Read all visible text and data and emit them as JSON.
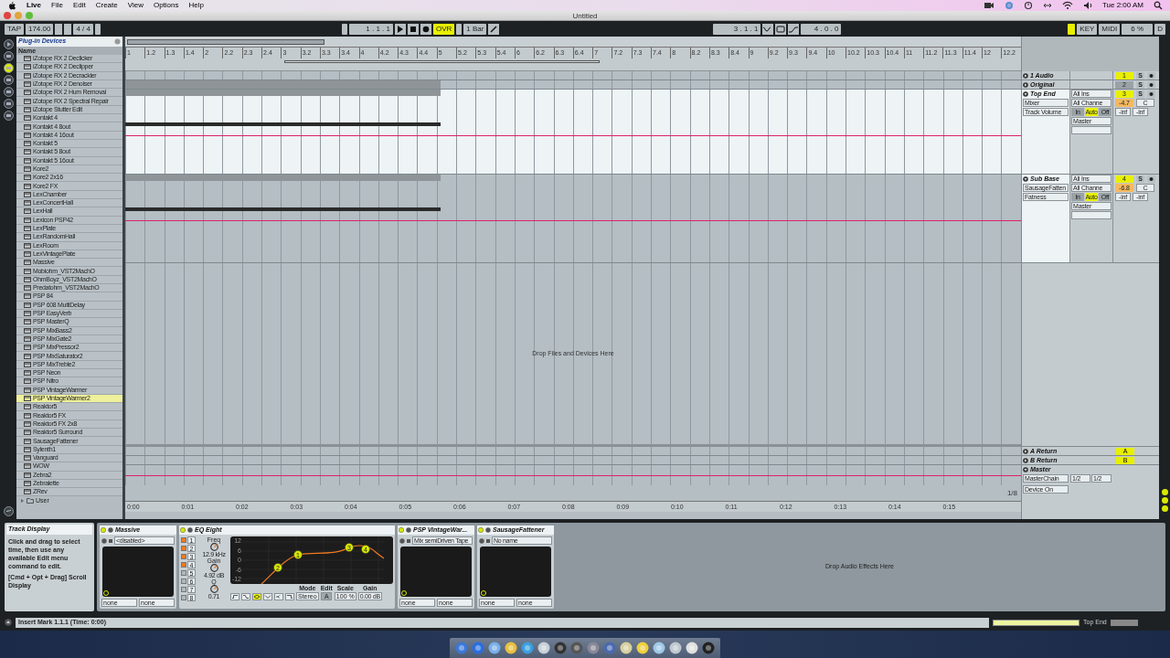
{
  "menubar": {
    "app": "Live",
    "menus": [
      "File",
      "Edit",
      "Create",
      "View",
      "Options",
      "Help"
    ],
    "clock": "Tue 2:00 AM"
  },
  "window": {
    "title": "Untitled"
  },
  "transport": {
    "tap": "TAP",
    "tempo": "174.00",
    "signature": "4 / 4",
    "position": "1 . 1 . 1",
    "overdub": "OVR",
    "overdub_on": true,
    "quantize": "1 Bar",
    "loop_start": "3 . 1 . 1",
    "loop_length": "4 . 0 . 0",
    "key": "KEY",
    "midi": "MIDI",
    "cpu": "6 %",
    "disk": "D"
  },
  "browser": {
    "title": "Plug-in Devices",
    "column": "Name",
    "items": [
      {
        "label": "iZotope RX 2 Declicker",
        "selected": false
      },
      {
        "label": "iZotope RX 2 Declipper",
        "selected": false
      },
      {
        "label": "iZotope RX 2 Decrackler",
        "selected": false
      },
      {
        "label": "iZotope RX 2 Denoiser",
        "selected": false
      },
      {
        "label": "iZotope RX 2 Hum Removal",
        "selected": false
      },
      {
        "label": "iZotope RX 2 Spectral Repair",
        "selected": false
      },
      {
        "label": "iZotope Stutter Edit",
        "selected": false
      },
      {
        "label": "Kontakt 4",
        "selected": false
      },
      {
        "label": "Kontakt 4 8out",
        "selected": false
      },
      {
        "label": "Kontakt 4 16out",
        "selected": false
      },
      {
        "label": "Kontakt 5",
        "selected": false
      },
      {
        "label": "Kontakt 5 8out",
        "selected": false
      },
      {
        "label": "Kontakt 5 16out",
        "selected": false
      },
      {
        "label": "Kore2",
        "selected": false
      },
      {
        "label": "Kore2 2x16",
        "selected": false
      },
      {
        "label": "Kore2 FX",
        "selected": false
      },
      {
        "label": "LexChamber",
        "selected": false
      },
      {
        "label": "LexConcertHall",
        "selected": false
      },
      {
        "label": "LexHall",
        "selected": false
      },
      {
        "label": "Lexicon PSP42",
        "selected": false
      },
      {
        "label": "LexPlate",
        "selected": false
      },
      {
        "label": "LexRandomHall",
        "selected": false
      },
      {
        "label": "LexRoom",
        "selected": false
      },
      {
        "label": "LexVintagePlate",
        "selected": false
      },
      {
        "label": "Massive",
        "selected": false
      },
      {
        "label": "Mobiohm_VST2MachO",
        "selected": false
      },
      {
        "label": "OhmBoyz_VST2MachO",
        "selected": false
      },
      {
        "label": "Predatohm_VST2MachO",
        "selected": false
      },
      {
        "label": "PSP 84",
        "selected": false
      },
      {
        "label": "PSP 608 MultiDelay",
        "selected": false
      },
      {
        "label": "PSP EasyVerb",
        "selected": false
      },
      {
        "label": "PSP MasterQ",
        "selected": false
      },
      {
        "label": "PSP MixBass2",
        "selected": false
      },
      {
        "label": "PSP MixGate2",
        "selected": false
      },
      {
        "label": "PSP MixPressor2",
        "selected": false
      },
      {
        "label": "PSP MixSaturator2",
        "selected": false
      },
      {
        "label": "PSP MixTreble2",
        "selected": false
      },
      {
        "label": "PSP Neon",
        "selected": false
      },
      {
        "label": "PSP Nitro",
        "selected": false
      },
      {
        "label": "PSP VintageWarmer",
        "selected": false
      },
      {
        "label": "PSP VintageWarmer2",
        "selected": true
      },
      {
        "label": "Reaktor5",
        "selected": false
      },
      {
        "label": "Reaktor5 FX",
        "selected": false
      },
      {
        "label": "Reaktor5 FX 2x8",
        "selected": false
      },
      {
        "label": "Reaktor5 Surround",
        "selected": false
      },
      {
        "label": "SausageFattener",
        "selected": false
      },
      {
        "label": "Sylenth1",
        "selected": false
      },
      {
        "label": "Vanguard",
        "selected": false
      },
      {
        "label": "WOW",
        "selected": false
      },
      {
        "label": "Zebra2",
        "selected": false
      },
      {
        "label": "Zebralette",
        "selected": false
      },
      {
        "label": "ZRev",
        "selected": false
      }
    ],
    "folder": "User"
  },
  "ruler": {
    "beats": [
      "1",
      "1.2",
      "1.3",
      "1.4",
      "2",
      "2.2",
      "2.3",
      "2.4",
      "3",
      "3.2",
      "3.3",
      "3.4",
      "4",
      "4.2",
      "4.3",
      "4.4",
      "5",
      "5.2",
      "5.3",
      "5.4",
      "6",
      "6.2",
      "6.3",
      "6.4",
      "7",
      "7.2",
      "7.3",
      "7.4",
      "8",
      "8.2",
      "8.3",
      "8.4",
      "9",
      "9.2",
      "9.3",
      "9.4",
      "10",
      "10.2",
      "10.3",
      "10.4",
      "11",
      "11.2",
      "11.3",
      "11.4",
      "12",
      "12.2"
    ],
    "times": [
      "0:00",
      "0:01",
      "0:02",
      "0:03",
      "0:04",
      "0:05",
      "0:06",
      "0:07",
      "0:08",
      "0:09",
      "0:10",
      "0:11",
      "0:12",
      "0:13",
      "0:14",
      "0:15"
    ],
    "grid": "1/8"
  },
  "tracks": [
    {
      "name": "1 Audio",
      "number": "1",
      "solo": "S",
      "active": true,
      "expanded": false,
      "clip": false
    },
    {
      "name": "Original",
      "number": "2",
      "solo": "S",
      "active": false,
      "expanded": false,
      "clip": true
    },
    {
      "name": "Top End",
      "number": "3",
      "solo": "S",
      "active": true,
      "expanded": true,
      "clip": true,
      "device": "Mixer",
      "parameter": "Track Volume",
      "input": "All Ins",
      "channel": "All Channe",
      "monitor": [
        {
          "label": "In",
          "selected": false
        },
        {
          "label": "Auto",
          "selected": true
        },
        {
          "label": "Off",
          "selected": false
        }
      ],
      "output": "Master",
      "volume": "-4.7",
      "pan": "C",
      "peak_left": "-inf",
      "peak_right": "-inf"
    },
    {
      "name": "Sub Base",
      "number": "4",
      "solo": "S",
      "active": true,
      "expanded": true,
      "clip": true,
      "device": "SausageFatten",
      "parameter": "Fatness",
      "input": "All Ins",
      "channel": "All Channe",
      "monitor": [
        {
          "label": "In",
          "selected": false
        },
        {
          "label": "Auto",
          "selected": true
        },
        {
          "label": "Off",
          "selected": false
        }
      ],
      "output": "Master",
      "volume": "-6.8",
      "pan": "C",
      "peak_left": "-inf",
      "peak_right": "-inf"
    }
  ],
  "drop_hint": "Drop Files and Devices Here",
  "returns": [
    {
      "name": "A Return",
      "letter": "A"
    },
    {
      "name": "B Return",
      "letter": "B"
    }
  ],
  "master": {
    "name": "Master",
    "device": "MasterChain",
    "parameter": "Device On",
    "cue": "1/2",
    "out": "1/2"
  },
  "track_display": {
    "title": "Track Display",
    "text": "Click and drag to select time, then use any available Edit menu command to edit.",
    "shortcut": "[Cmd + Opt + Drag] Scroll Display"
  },
  "devices": [
    {
      "kind": "plugin",
      "name": "Massive",
      "preset": "<disabled>",
      "params": [
        "none",
        "none"
      ]
    },
    {
      "kind": "eq",
      "name": "EQ Eight",
      "bands": [
        {
          "label": "1",
          "on": true
        },
        {
          "label": "2",
          "on": true
        },
        {
          "label": "3",
          "on": true
        },
        {
          "label": "4",
          "on": true
        },
        {
          "label": "5",
          "on": false
        },
        {
          "label": "6",
          "on": false
        },
        {
          "label": "7",
          "on": false
        },
        {
          "label": "8",
          "on": false
        }
      ],
      "freq_label": "Freq",
      "freq": "12.9 kHz",
      "gain_label": "Gain",
      "gain": "4.92 dB",
      "q_label": "Q",
      "q": "0.71",
      "db_ticks": [
        "12",
        "6",
        "0",
        "-6",
        "-12"
      ],
      "points": [
        "1",
        "2",
        "3",
        "4"
      ],
      "shapes": [
        {
          "selected": false
        },
        {
          "selected": false
        },
        {
          "selected": true
        },
        {
          "selected": false
        },
        {
          "selected": false
        },
        {
          "selected": false
        }
      ],
      "mode_label": "Mode",
      "mode": "Stereo",
      "edit_label": "Edit",
      "edit": "A",
      "scale_label": "Scale",
      "scale": "100 %",
      "out_label": "Gain",
      "out": "0.00 dB"
    },
    {
      "kind": "plugin",
      "name": "PSP VintageWar...",
      "preset": "Mix semiDriven Tape",
      "params": [
        "none",
        "none"
      ]
    },
    {
      "kind": "plugin",
      "name": "SausageFattener",
      "preset": "No name",
      "params": [
        "none",
        "none"
      ]
    }
  ],
  "device_drop_hint": "Drop Audio Effects Here",
  "status": {
    "text": "Insert Mark 1.1.1 (Time: 0:00)",
    "track": "Top End"
  }
}
